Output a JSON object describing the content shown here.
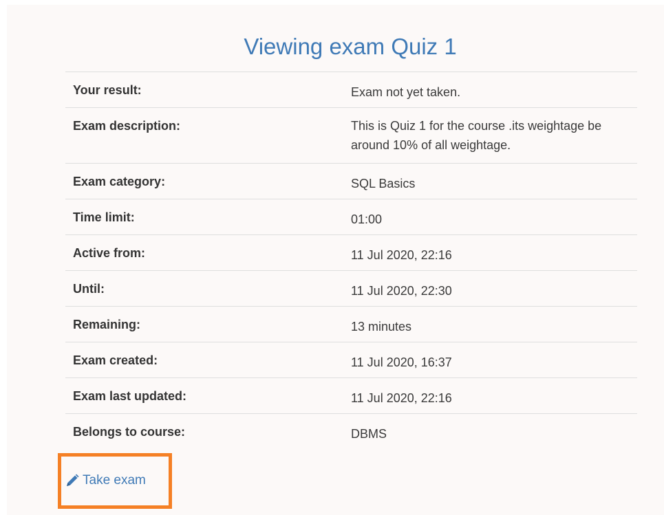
{
  "page_title": "Viewing exam Quiz 1",
  "details": [
    {
      "label": "Your result:",
      "value": "Exam not yet taken."
    },
    {
      "label": "Exam description:",
      "value": "This is Quiz 1 for the course .its weightage be around 10% of all weightage."
    },
    {
      "label": "Exam category:",
      "value": "SQL Basics"
    },
    {
      "label": "Time limit:",
      "value": "01:00"
    },
    {
      "label": "Active from:",
      "value": "11 Jul 2020, 22:16"
    },
    {
      "label": "Until:",
      "value": "11 Jul 2020, 22:30"
    },
    {
      "label": "Remaining:",
      "value": "13 minutes"
    },
    {
      "label": "Exam created:",
      "value": "11 Jul 2020, 16:37"
    },
    {
      "label": "Exam last updated:",
      "value": "11 Jul 2020, 22:16"
    },
    {
      "label": "Belongs to course:",
      "value": "DBMS"
    }
  ],
  "take_exam": {
    "label": "Take exam",
    "icon": "pencil-icon"
  },
  "colors": {
    "title": "#3f7ab6",
    "link": "#3f7ab6",
    "highlight": "#f58025",
    "panel_bg": "#fcf9f8",
    "row_divider": "#dedede"
  }
}
